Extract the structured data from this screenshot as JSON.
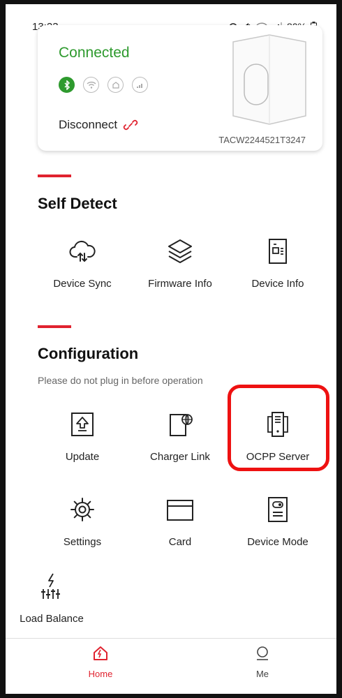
{
  "status_bar": {
    "time": "13:23",
    "battery": "80%"
  },
  "device": {
    "status": "Connected",
    "disconnect_label": "Disconnect",
    "serial": "TACW2244521T3247"
  },
  "self_detect": {
    "title": "Self Detect",
    "items": [
      {
        "label": "Device Sync",
        "icon": "cloud-sync-icon"
      },
      {
        "label": "Firmware Info",
        "icon": "layers-icon"
      },
      {
        "label": "Device Info",
        "icon": "document-icon"
      }
    ]
  },
  "configuration": {
    "title": "Configuration",
    "note": "Please do not plug in before operation",
    "items": [
      {
        "label": "Update",
        "icon": "upload-icon"
      },
      {
        "label": "Charger Link",
        "icon": "charger-link-icon"
      },
      {
        "label": "OCPP Server",
        "icon": "server-icon"
      },
      {
        "label": "Settings",
        "icon": "gear-icon"
      },
      {
        "label": "Card",
        "icon": "card-icon"
      },
      {
        "label": "Device Mode",
        "icon": "device-mode-icon"
      },
      {
        "label": "Load Balance",
        "icon": "load-balance-icon"
      }
    ]
  },
  "bottom_nav": [
    {
      "label": "Home",
      "icon": "home-icon",
      "active": true
    },
    {
      "label": "Me",
      "icon": "person-icon",
      "active": false
    }
  ],
  "colors": {
    "accent": "#e0222f",
    "connected": "#2e9a2e",
    "highlight": "#e11111"
  }
}
